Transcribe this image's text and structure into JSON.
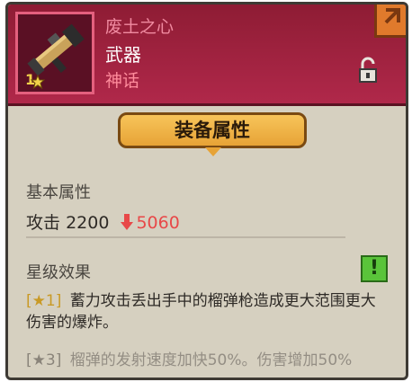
{
  "item": {
    "name": "废土之心",
    "type": "武器",
    "rarity": "神话",
    "star_level": "1"
  },
  "tabs": {
    "active_label": "装备属性"
  },
  "base_attributes": {
    "title": "基本属性",
    "attack_label": "攻击",
    "attack_value": "2200",
    "attack_max": "5060"
  },
  "star_effects": {
    "title": "星级效果",
    "badge": "!",
    "effects": [
      {
        "tag": "[★1]",
        "text": "蓄力攻击丢出手中的榴弹枪造成更大范围更大伤害的爆炸。"
      },
      {
        "tag": "[★3]",
        "text": "榴弹的发射速度加快50%。伤害增加50%"
      }
    ]
  },
  "colors": {
    "header": "#b0284a",
    "tab": "#e7a336",
    "attack_max": "#e84848",
    "badge": "#5ac43a"
  }
}
